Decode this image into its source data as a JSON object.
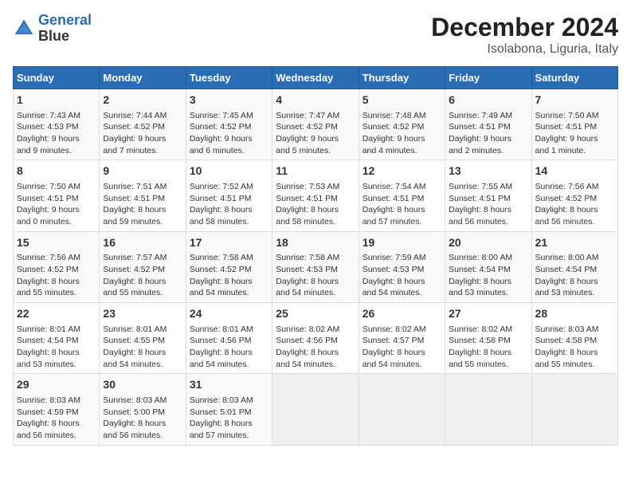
{
  "logo": {
    "line1": "General",
    "line2": "Blue"
  },
  "title": "December 2024",
  "subtitle": "Isolabona, Liguria, Italy",
  "weekdays": [
    "Sunday",
    "Monday",
    "Tuesday",
    "Wednesday",
    "Thursday",
    "Friday",
    "Saturday"
  ],
  "weeks": [
    [
      {
        "day": "1",
        "info": "Sunrise: 7:43 AM\nSunset: 4:53 PM\nDaylight: 9 hours\nand 9 minutes."
      },
      {
        "day": "2",
        "info": "Sunrise: 7:44 AM\nSunset: 4:52 PM\nDaylight: 9 hours\nand 7 minutes."
      },
      {
        "day": "3",
        "info": "Sunrise: 7:45 AM\nSunset: 4:52 PM\nDaylight: 9 hours\nand 6 minutes."
      },
      {
        "day": "4",
        "info": "Sunrise: 7:47 AM\nSunset: 4:52 PM\nDaylight: 9 hours\nand 5 minutes."
      },
      {
        "day": "5",
        "info": "Sunrise: 7:48 AM\nSunset: 4:52 PM\nDaylight: 9 hours\nand 4 minutes."
      },
      {
        "day": "6",
        "info": "Sunrise: 7:49 AM\nSunset: 4:51 PM\nDaylight: 9 hours\nand 2 minutes."
      },
      {
        "day": "7",
        "info": "Sunrise: 7:50 AM\nSunset: 4:51 PM\nDaylight: 9 hours\nand 1 minute."
      }
    ],
    [
      {
        "day": "8",
        "info": "Sunrise: 7:50 AM\nSunset: 4:51 PM\nDaylight: 9 hours\nand 0 minutes."
      },
      {
        "day": "9",
        "info": "Sunrise: 7:51 AM\nSunset: 4:51 PM\nDaylight: 8 hours\nand 59 minutes."
      },
      {
        "day": "10",
        "info": "Sunrise: 7:52 AM\nSunset: 4:51 PM\nDaylight: 8 hours\nand 58 minutes."
      },
      {
        "day": "11",
        "info": "Sunrise: 7:53 AM\nSunset: 4:51 PM\nDaylight: 8 hours\nand 58 minutes."
      },
      {
        "day": "12",
        "info": "Sunrise: 7:54 AM\nSunset: 4:51 PM\nDaylight: 8 hours\nand 57 minutes."
      },
      {
        "day": "13",
        "info": "Sunrise: 7:55 AM\nSunset: 4:51 PM\nDaylight: 8 hours\nand 56 minutes."
      },
      {
        "day": "14",
        "info": "Sunrise: 7:56 AM\nSunset: 4:52 PM\nDaylight: 8 hours\nand 56 minutes."
      }
    ],
    [
      {
        "day": "15",
        "info": "Sunrise: 7:56 AM\nSunset: 4:52 PM\nDaylight: 8 hours\nand 55 minutes."
      },
      {
        "day": "16",
        "info": "Sunrise: 7:57 AM\nSunset: 4:52 PM\nDaylight: 8 hours\nand 55 minutes."
      },
      {
        "day": "17",
        "info": "Sunrise: 7:58 AM\nSunset: 4:52 PM\nDaylight: 8 hours\nand 54 minutes."
      },
      {
        "day": "18",
        "info": "Sunrise: 7:58 AM\nSunset: 4:53 PM\nDaylight: 8 hours\nand 54 minutes."
      },
      {
        "day": "19",
        "info": "Sunrise: 7:59 AM\nSunset: 4:53 PM\nDaylight: 8 hours\nand 54 minutes."
      },
      {
        "day": "20",
        "info": "Sunrise: 8:00 AM\nSunset: 4:54 PM\nDaylight: 8 hours\nand 53 minutes."
      },
      {
        "day": "21",
        "info": "Sunrise: 8:00 AM\nSunset: 4:54 PM\nDaylight: 8 hours\nand 53 minutes."
      }
    ],
    [
      {
        "day": "22",
        "info": "Sunrise: 8:01 AM\nSunset: 4:54 PM\nDaylight: 8 hours\nand 53 minutes."
      },
      {
        "day": "23",
        "info": "Sunrise: 8:01 AM\nSunset: 4:55 PM\nDaylight: 8 hours\nand 54 minutes."
      },
      {
        "day": "24",
        "info": "Sunrise: 8:01 AM\nSunset: 4:56 PM\nDaylight: 8 hours\nand 54 minutes."
      },
      {
        "day": "25",
        "info": "Sunrise: 8:02 AM\nSunset: 4:56 PM\nDaylight: 8 hours\nand 54 minutes."
      },
      {
        "day": "26",
        "info": "Sunrise: 8:02 AM\nSunset: 4:57 PM\nDaylight: 8 hours\nand 54 minutes."
      },
      {
        "day": "27",
        "info": "Sunrise: 8:02 AM\nSunset: 4:58 PM\nDaylight: 8 hours\nand 55 minutes."
      },
      {
        "day": "28",
        "info": "Sunrise: 8:03 AM\nSunset: 4:58 PM\nDaylight: 8 hours\nand 55 minutes."
      }
    ],
    [
      {
        "day": "29",
        "info": "Sunrise: 8:03 AM\nSunset: 4:59 PM\nDaylight: 8 hours\nand 56 minutes."
      },
      {
        "day": "30",
        "info": "Sunrise: 8:03 AM\nSunset: 5:00 PM\nDaylight: 8 hours\nand 56 minutes."
      },
      {
        "day": "31",
        "info": "Sunrise: 8:03 AM\nSunset: 5:01 PM\nDaylight: 8 hours\nand 57 minutes."
      },
      null,
      null,
      null,
      null
    ]
  ]
}
